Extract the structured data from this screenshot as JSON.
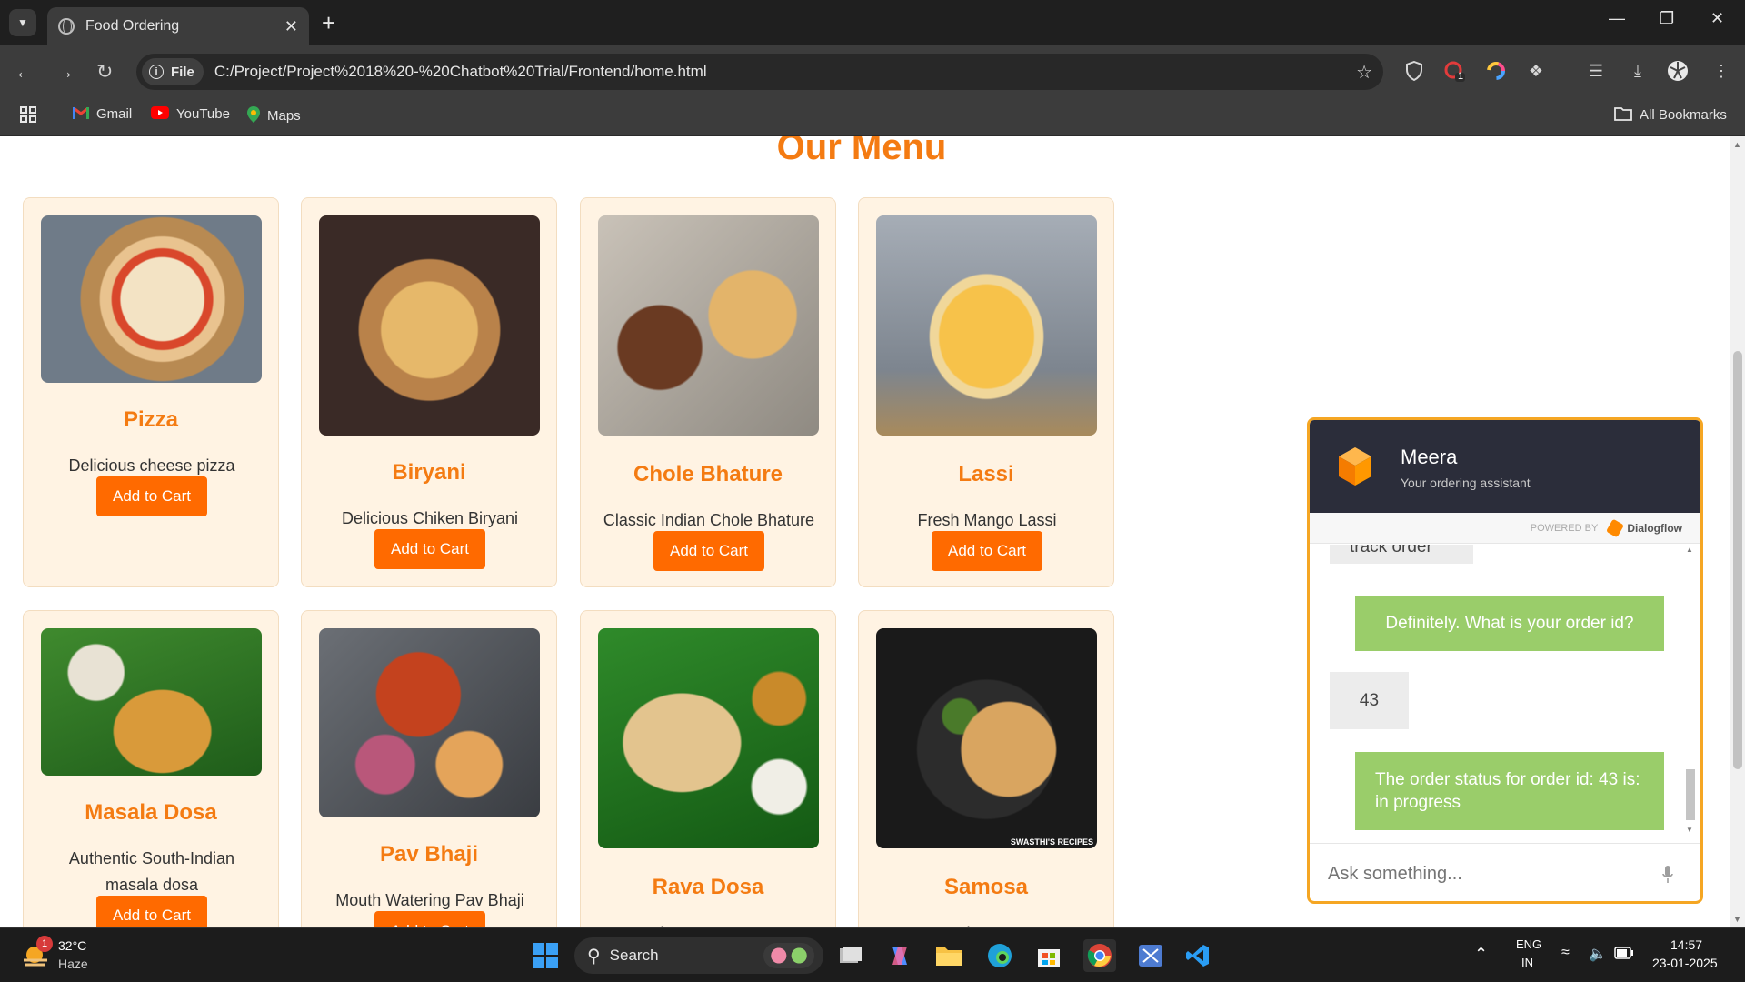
{
  "browser": {
    "tab_title": "Food Ordering",
    "url_scheme": "File",
    "url": "C:/Project/Project%2018%20-%20Chatbot%20Trial/Frontend/home.html",
    "bookmarks": [
      {
        "label": "Gmail",
        "icon": "gmail-icon"
      },
      {
        "label": "YouTube",
        "icon": "youtube-icon"
      },
      {
        "label": "Maps",
        "icon": "maps-icon"
      }
    ],
    "all_bookmarks": "All Bookmarks",
    "extension_badge": "1"
  },
  "page": {
    "title": "Our Menu",
    "add_to_cart": "Add to Cart",
    "items": [
      {
        "name": "Pizza",
        "desc": "Delicious cheese pizza"
      },
      {
        "name": "Biryani",
        "desc": "Delicious Chiken Biryani"
      },
      {
        "name": "Chole Bhature",
        "desc": "Classic Indian Chole Bhature"
      },
      {
        "name": "Lassi",
        "desc": "Fresh Mango Lassi"
      },
      {
        "name": "Masala Dosa",
        "desc": "Authentic South-Indian masala dosa"
      },
      {
        "name": "Pav Bhaji",
        "desc": "Mouth Watering Pav Bhaji"
      },
      {
        "name": "Rava Dosa",
        "desc": "Crispy Rava Dosa"
      },
      {
        "name": "Samosa",
        "desc": "Fresh Samosa"
      }
    ],
    "image_credit": "SWASTHI'S RECIPES"
  },
  "chat": {
    "agent_name": "Meera",
    "agent_subtitle": "Your ordering assistant",
    "powered_by": "POWERED BY",
    "provider": "Dialogflow",
    "messages": [
      {
        "from": "user",
        "text": "track order"
      },
      {
        "from": "bot",
        "text": "Definitely. What is your order id?"
      },
      {
        "from": "user",
        "text": "43"
      },
      {
        "from": "bot",
        "text": "The order status for order id: 43 is: in progress"
      }
    ],
    "input_placeholder": "Ask something..."
  },
  "taskbar": {
    "weather_temp": "32°C",
    "weather_desc": "Haze",
    "weather_badge": "1",
    "search_label": "Search",
    "lang_top": "ENG",
    "lang_bottom": "IN",
    "time": "14:57",
    "date": "23-01-2025"
  },
  "colors": {
    "accent": "#f47b12",
    "button": "#ff6a00",
    "card_bg": "#fff3e3",
    "bot_bubble": "#9acd6a",
    "chat_header": "#2b2d3a"
  }
}
